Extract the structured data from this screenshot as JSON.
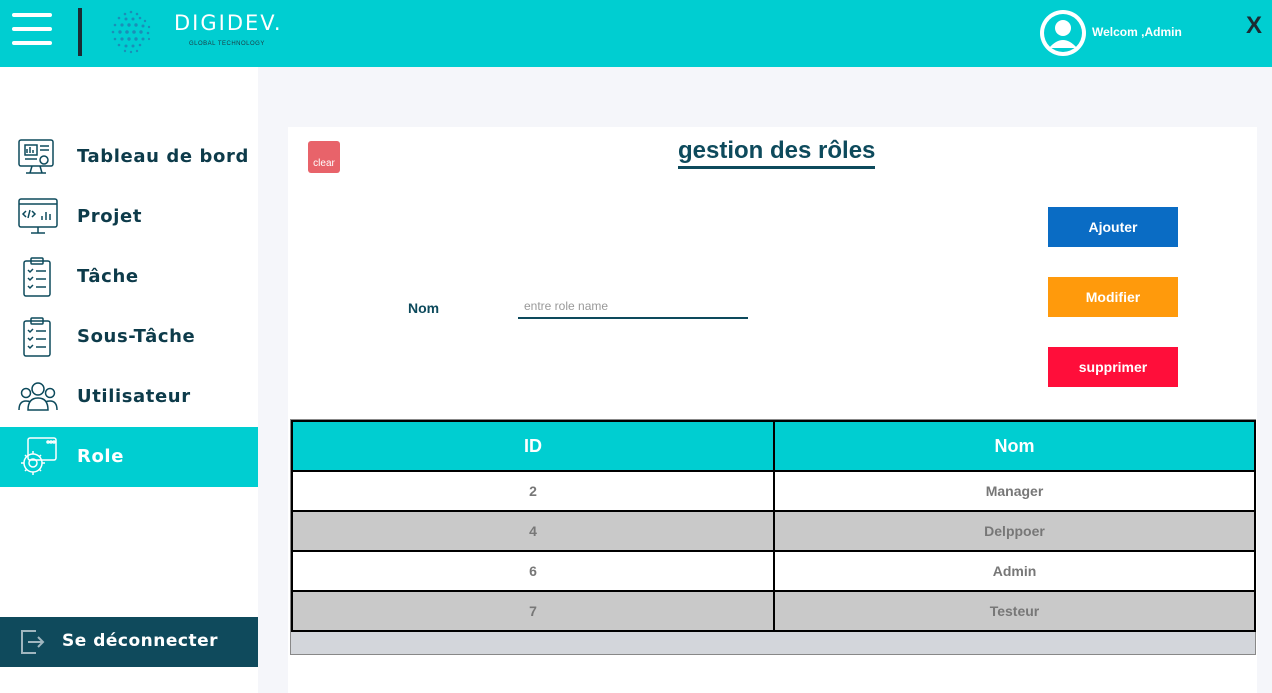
{
  "header": {
    "brand": "DIGIDEV.",
    "brand_sub": "GLOBAL TECHNOLOGY",
    "welcome": "Welcom ,Admin",
    "close_label": "X"
  },
  "sidebar": {
    "items": [
      {
        "label": "Tableau de bord",
        "icon": "dashboard-icon"
      },
      {
        "label": "Projet",
        "icon": "code-monitor-icon"
      },
      {
        "label": "Tâche",
        "icon": "clipboard-checklist-icon"
      },
      {
        "label": "Sous-Tâche",
        "icon": "clipboard-checklist-icon"
      },
      {
        "label": "Utilisateur",
        "icon": "users-icon"
      },
      {
        "label": "Role",
        "icon": "gear-window-icon",
        "active": true
      }
    ],
    "logout_label": "Se déconnecter"
  },
  "main": {
    "clear_label": "clear",
    "title": "gestion des rôles",
    "form": {
      "nom_label": "Nom",
      "nom_value": "",
      "nom_placeholder": "entre role name"
    },
    "buttons": {
      "add": "Ajouter",
      "edit": "Modifier",
      "delete": "supprimer"
    },
    "table": {
      "columns": [
        "ID",
        "Nom"
      ],
      "rows": [
        {
          "id": "2",
          "nom": "Manager"
        },
        {
          "id": "4",
          "nom": "Delppoer"
        },
        {
          "id": "6",
          "nom": "Admin"
        },
        {
          "id": "7",
          "nom": "Testeur"
        }
      ]
    }
  },
  "colors": {
    "accent": "#00ced1",
    "dark": "#0d4a5c",
    "add": "#0a6cc4",
    "edit": "#ff9a0c",
    "delete": "#ff0e3a"
  }
}
